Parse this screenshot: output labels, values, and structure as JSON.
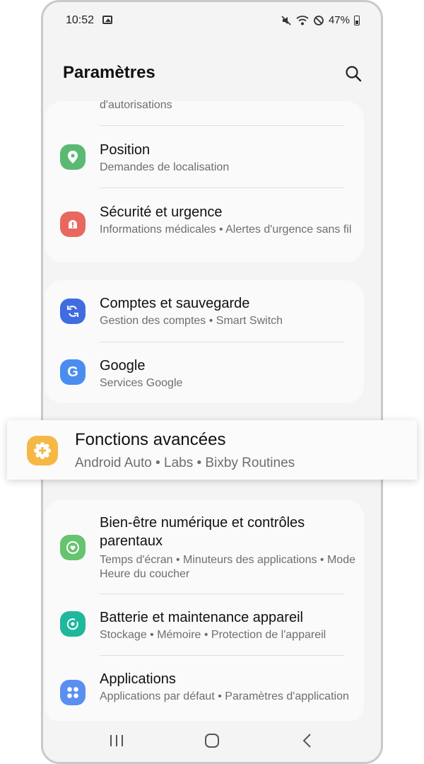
{
  "status_bar": {
    "time": "10:52",
    "battery": "47%"
  },
  "header": {
    "title": "Paramètres"
  },
  "sections": {
    "top_partial": {
      "sub": "d'autorisations"
    },
    "position": {
      "title": "Position",
      "sub": "Demandes de localisation"
    },
    "security": {
      "title": "Sécurité et urgence",
      "sub": "Informations médicales  •  Alertes d'urgence sans fil"
    },
    "accounts": {
      "title": "Comptes et sauvegarde",
      "sub": "Gestion des comptes  •  Smart Switch"
    },
    "google": {
      "title": "Google",
      "sub": "Services Google"
    },
    "advanced": {
      "title": "Fonctions avancées",
      "sub": "Android Auto  •  Labs  •  Bixby Routines"
    },
    "wellbeing": {
      "title": "Bien-être numérique et contrôles parentaux",
      "sub": "Temps d'écran  •  Minuteurs des applications  •  Mode Heure du coucher"
    },
    "battery": {
      "title": "Batterie et maintenance appareil",
      "sub": "Stockage  •  Mémoire  •  Protection de l'appareil"
    },
    "apps": {
      "title": "Applications",
      "sub": "Applications par défaut  •  Paramètres d'application"
    }
  },
  "colors": {
    "position_icon": "#5bb974",
    "security_icon": "#e8685f",
    "accounts_icon": "#3f6ce0",
    "google_icon": "#4a8df0",
    "advanced_icon": "#f6b844",
    "wellbeing_icon": "#65c46d",
    "battery_icon": "#1fb89c",
    "apps_icon": "#5a8ff0"
  },
  "icons": [
    "image-icon",
    "mute-icon",
    "wifi-icon",
    "dnd-icon",
    "battery-icon",
    "search-icon",
    "location-pin-icon",
    "alert-icon",
    "sync-icon",
    "google-g-icon",
    "gear-plus-icon",
    "wellbeing-icon",
    "battery-care-icon",
    "apps-grid-icon",
    "recents-icon",
    "home-icon",
    "back-icon"
  ]
}
